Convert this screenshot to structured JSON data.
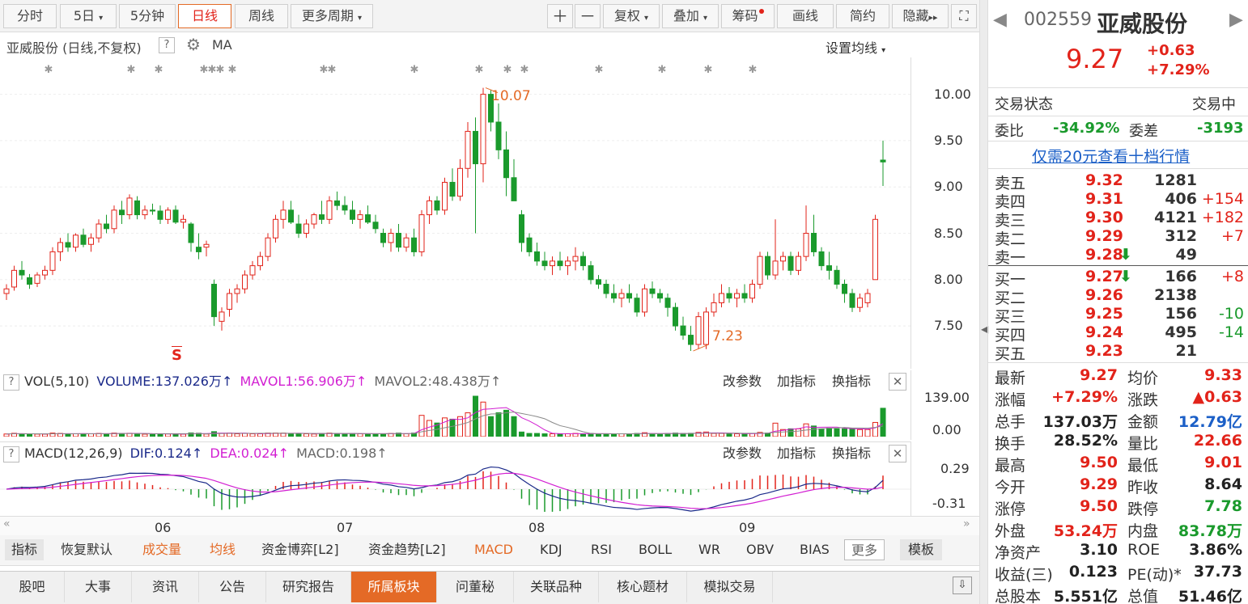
{
  "toolbar": {
    "tabs": [
      "分时",
      "5日",
      "5分钟",
      "日线",
      "周线",
      "更多周期"
    ],
    "active": "日线",
    "right": [
      "复权",
      "叠加",
      "筹码",
      "画线",
      "简约",
      "隐藏"
    ]
  },
  "chart": {
    "title": "亚威股份 (日线,不复权)",
    "ma_label": "MA",
    "ma_settings": "设置均线",
    "high_label": "10.07",
    "low_label": "7.23",
    "y_ticks": [
      "10.00",
      "9.50",
      "9.00",
      "8.50",
      "8.00",
      "7.50"
    ],
    "s_marker": "S"
  },
  "vol": {
    "label": "VOL(5,10)",
    "volume": "VOLUME:137.026万",
    "mavol1": "MAVOL1:56.906万",
    "mavol2": "MAVOL2:48.438万",
    "y_ticks": [
      "139.00",
      "0.00"
    ]
  },
  "macd": {
    "label": "MACD(12,26,9)",
    "dif": "DIF:0.124",
    "dea": "DEA:0.024",
    "macd": "MACD:0.198",
    "y_ticks": [
      "0.29",
      "-0.31"
    ]
  },
  "indicator_tools": [
    "改参数",
    "加指标",
    "换指标"
  ],
  "x_months": [
    "06",
    "07",
    "08",
    "09"
  ],
  "param_tabs": [
    "指标",
    "恢复默认",
    "成交量",
    "均线",
    "资金博弈[L2]",
    "资金趋势[L2]",
    "MACD",
    "KDJ",
    "RSI",
    "BOLL",
    "WR",
    "OBV",
    "BIAS",
    "更多",
    "模板"
  ],
  "bottom_tabs": [
    "股吧",
    "大事",
    "资讯",
    "公告",
    "研究报告",
    "所属板块",
    "问董秘",
    "关联品种",
    "核心题材",
    "模拟交易"
  ],
  "bottom_active": "所属板块",
  "stock": {
    "code": "002559",
    "name": "亚威股份",
    "price": "9.27",
    "change": "+0.63",
    "pct": "+7.29%"
  },
  "status": {
    "label": "交易状态",
    "value": "交易中"
  },
  "weibi": {
    "label": "委比",
    "value": "-34.92%",
    "diff_label": "委差",
    "diff": "-3193"
  },
  "promo": "仅需20元查看十档行情",
  "asks": [
    {
      "label": "卖五",
      "price": "9.32",
      "vol": "1281",
      "chg": ""
    },
    {
      "label": "卖四",
      "price": "9.31",
      "vol": "406",
      "chg": "+154"
    },
    {
      "label": "卖三",
      "price": "9.30",
      "vol": "4121",
      "chg": "+182"
    },
    {
      "label": "卖二",
      "price": "9.29",
      "vol": "312",
      "chg": "+7"
    },
    {
      "label": "卖一",
      "price": "9.28",
      "vol": "49",
      "chg": ""
    }
  ],
  "bids": [
    {
      "label": "买一",
      "price": "9.27",
      "vol": "166",
      "chg": "+8"
    },
    {
      "label": "买二",
      "price": "9.26",
      "vol": "2138",
      "chg": ""
    },
    {
      "label": "买三",
      "price": "9.25",
      "vol": "156",
      "chg": "-10"
    },
    {
      "label": "买四",
      "price": "9.24",
      "vol": "495",
      "chg": "-14"
    },
    {
      "label": "买五",
      "price": "9.23",
      "vol": "21",
      "chg": ""
    }
  ],
  "stats": [
    {
      "l1": "最新",
      "v1": "9.27",
      "c1": "red",
      "l2": "均价",
      "v2": "9.33",
      "c2": "red"
    },
    {
      "l1": "涨幅",
      "v1": "+7.29%",
      "c1": "red",
      "l2": "涨跌",
      "v2": "▲0.63",
      "c2": "red"
    },
    {
      "l1": "总手",
      "v1": "137.03万",
      "c1": "",
      "l2": "金额",
      "v2": "12.79亿",
      "c2": "blue"
    },
    {
      "l1": "换手",
      "v1": "28.52%",
      "c1": "",
      "l2": "量比",
      "v2": "22.66",
      "c2": "red"
    },
    {
      "l1": "最高",
      "v1": "9.50",
      "c1": "red",
      "l2": "最低",
      "v2": "9.01",
      "c2": "red"
    },
    {
      "l1": "今开",
      "v1": "9.29",
      "c1": "red",
      "l2": "昨收",
      "v2": "8.64",
      "c2": ""
    },
    {
      "l1": "涨停",
      "v1": "9.50",
      "c1": "red",
      "l2": "跌停",
      "v2": "7.78",
      "c2": "green"
    },
    {
      "l1": "外盘",
      "v1": "53.24万",
      "c1": "red",
      "l2": "内盘",
      "v2": "83.78万",
      "c2": "green"
    },
    {
      "l1": "净资产",
      "v1": "3.10",
      "c1": "",
      "l2": "ROE",
      "v2": "3.86%",
      "c2": ""
    },
    {
      "l1": "收益(三)",
      "v1": "0.123",
      "c1": "",
      "l2": "PE(动)*",
      "v2": "37.73",
      "c2": ""
    },
    {
      "l1": "总股本",
      "v1": "5.551亿",
      "c1": "",
      "l2": "总值",
      "v2": "51.46亿",
      "c2": ""
    }
  ],
  "colors": {
    "up": "#e2231a",
    "down": "#1a9a2c",
    "accent": "#e46a26",
    "link": "#1b5fc7"
  },
  "chart_data": {
    "type": "candlestick",
    "candles": [
      [
        7.85,
        7.95,
        7.78,
        7.9
      ],
      [
        7.92,
        8.15,
        7.88,
        8.1
      ],
      [
        8.1,
        8.2,
        8.0,
        8.05
      ],
      [
        8.02,
        8.06,
        7.9,
        7.95
      ],
      [
        7.96,
        8.08,
        7.92,
        8.05
      ],
      [
        8.05,
        8.15,
        8.0,
        8.1
      ],
      [
        8.1,
        8.35,
        8.05,
        8.3
      ],
      [
        8.3,
        8.45,
        8.2,
        8.4
      ],
      [
        8.4,
        8.5,
        8.3,
        8.35
      ],
      [
        8.35,
        8.5,
        8.3,
        8.48
      ],
      [
        8.48,
        8.55,
        8.35,
        8.38
      ],
      [
        8.38,
        8.5,
        8.3,
        8.45
      ],
      [
        8.45,
        8.65,
        8.4,
        8.6
      ],
      [
        8.6,
        8.7,
        8.5,
        8.55
      ],
      [
        8.55,
        8.8,
        8.5,
        8.75
      ],
      [
        8.75,
        8.85,
        8.6,
        8.7
      ],
      [
        8.7,
        8.92,
        8.65,
        8.88
      ],
      [
        8.85,
        8.9,
        8.65,
        8.7
      ],
      [
        8.7,
        8.8,
        8.65,
        8.75
      ],
      [
        8.75,
        8.82,
        8.7,
        8.74
      ],
      [
        8.74,
        8.8,
        8.6,
        8.65
      ],
      [
        8.65,
        8.78,
        8.6,
        8.75
      ],
      [
        8.75,
        8.8,
        8.6,
        8.62
      ],
      [
        8.62,
        8.7,
        8.55,
        8.65
      ],
      [
        8.6,
        8.62,
        8.3,
        8.4
      ],
      [
        8.35,
        8.5,
        8.22,
        8.3
      ],
      [
        8.35,
        8.42,
        8.25,
        8.38
      ],
      [
        7.95,
        8.0,
        7.5,
        7.6
      ],
      [
        7.55,
        7.7,
        7.45,
        7.65
      ],
      [
        7.68,
        7.9,
        7.6,
        7.85
      ],
      [
        7.85,
        7.95,
        7.75,
        7.9
      ],
      [
        7.9,
        8.1,
        7.85,
        8.05
      ],
      [
        8.05,
        8.2,
        8.0,
        8.15
      ],
      [
        8.15,
        8.3,
        8.1,
        8.25
      ],
      [
        8.25,
        8.5,
        8.2,
        8.45
      ],
      [
        8.45,
        8.7,
        8.4,
        8.65
      ],
      [
        8.65,
        8.85,
        8.55,
        8.75
      ],
      [
        8.75,
        8.85,
        8.6,
        8.62
      ],
      [
        8.6,
        8.7,
        8.45,
        8.5
      ],
      [
        8.5,
        8.65,
        8.45,
        8.6
      ],
      [
        8.6,
        8.72,
        8.55,
        8.7
      ],
      [
        8.7,
        8.85,
        8.6,
        8.65
      ],
      [
        8.65,
        8.9,
        8.6,
        8.85
      ],
      [
        8.85,
        8.95,
        8.75,
        8.8
      ],
      [
        8.8,
        8.9,
        8.7,
        8.75
      ],
      [
        8.75,
        8.85,
        8.6,
        8.65
      ],
      [
        8.65,
        8.75,
        8.55,
        8.7
      ],
      [
        8.7,
        8.8,
        8.6,
        8.62
      ],
      [
        8.62,
        8.7,
        8.5,
        8.55
      ],
      [
        8.5,
        8.55,
        8.35,
        8.4
      ],
      [
        8.4,
        8.55,
        8.3,
        8.5
      ],
      [
        8.5,
        8.6,
        8.3,
        8.35
      ],
      [
        8.35,
        8.5,
        8.3,
        8.45
      ],
      [
        8.45,
        8.55,
        8.25,
        8.3
      ],
      [
        8.3,
        8.75,
        8.25,
        8.7
      ],
      [
        8.7,
        8.9,
        8.6,
        8.85
      ],
      [
        8.85,
        8.9,
        8.7,
        8.75
      ],
      [
        8.75,
        9.1,
        8.7,
        9.05
      ],
      [
        9.05,
        9.2,
        8.85,
        8.9
      ],
      [
        8.9,
        9.3,
        8.85,
        9.2
      ],
      [
        9.2,
        9.7,
        9.1,
        9.6
      ],
      [
        9.6,
        9.75,
        8.5,
        9.25
      ],
      [
        9.25,
        10.07,
        9.05,
        10.0
      ],
      [
        10.0,
        10.05,
        9.6,
        9.7
      ],
      [
        9.7,
        9.9,
        9.3,
        9.4
      ],
      [
        9.4,
        9.6,
        8.9,
        9.1
      ],
      [
        9.1,
        9.3,
        8.85,
        8.85
      ],
      [
        8.7,
        8.75,
        8.3,
        8.4
      ],
      [
        8.45,
        8.5,
        8.25,
        8.3
      ],
      [
        8.3,
        8.4,
        8.15,
        8.2
      ],
      [
        8.2,
        8.3,
        8.1,
        8.15
      ],
      [
        8.15,
        8.25,
        8.05,
        8.2
      ],
      [
        8.2,
        8.3,
        8.1,
        8.15
      ],
      [
        8.15,
        8.25,
        8.05,
        8.2
      ],
      [
        8.2,
        8.35,
        8.1,
        8.25
      ],
      [
        8.25,
        8.3,
        8.1,
        8.15
      ],
      [
        8.15,
        8.2,
        7.95,
        8.0
      ],
      [
        8.0,
        8.05,
        7.9,
        7.95
      ],
      [
        7.95,
        8.0,
        7.8,
        7.85
      ],
      [
        7.85,
        7.95,
        7.75,
        7.8
      ],
      [
        7.8,
        7.9,
        7.7,
        7.85
      ],
      [
        7.85,
        7.95,
        7.75,
        7.8
      ],
      [
        7.8,
        7.85,
        7.6,
        7.65
      ],
      [
        7.65,
        7.95,
        7.6,
        7.9
      ],
      [
        7.9,
        7.98,
        7.8,
        7.85
      ],
      [
        7.85,
        7.9,
        7.75,
        7.8
      ],
      [
        7.8,
        7.85,
        7.6,
        7.7
      ],
      [
        7.7,
        7.75,
        7.45,
        7.5
      ],
      [
        7.5,
        7.6,
        7.35,
        7.4
      ],
      [
        7.4,
        7.5,
        7.23,
        7.3
      ],
      [
        7.3,
        7.65,
        7.25,
        7.6
      ],
      [
        7.3,
        7.7,
        7.25,
        7.65
      ],
      [
        7.65,
        7.85,
        7.6,
        7.75
      ],
      [
        7.75,
        7.95,
        7.7,
        7.85
      ],
      [
        7.85,
        7.92,
        7.75,
        7.8
      ],
      [
        7.8,
        7.9,
        7.7,
        7.85
      ],
      [
        7.85,
        7.95,
        7.75,
        7.8
      ],
      [
        7.8,
        8.0,
        7.75,
        7.95
      ],
      [
        7.95,
        8.3,
        7.9,
        8.25
      ],
      [
        8.25,
        8.3,
        8.0,
        8.05
      ],
      [
        8.05,
        8.65,
        8.0,
        8.2
      ],
      [
        8.2,
        8.3,
        8.1,
        8.25
      ],
      [
        8.25,
        8.3,
        8.05,
        8.1
      ],
      [
        8.1,
        8.3,
        8.05,
        8.25
      ],
      [
        8.25,
        8.8,
        8.2,
        8.5
      ],
      [
        8.5,
        8.7,
        8.25,
        8.3
      ],
      [
        8.3,
        8.35,
        8.1,
        8.15
      ],
      [
        8.15,
        8.3,
        8.0,
        8.1
      ],
      [
        8.1,
        8.15,
        7.9,
        7.95
      ],
      [
        7.95,
        8.0,
        7.75,
        7.85
      ],
      [
        7.85,
        7.9,
        7.65,
        7.7
      ],
      [
        7.7,
        7.85,
        7.65,
        7.8
      ],
      [
        7.75,
        7.9,
        7.7,
        7.85
      ],
      [
        8.0,
        8.7,
        8.0,
        8.65
      ],
      [
        9.29,
        9.5,
        9.01,
        9.27
      ]
    ]
  }
}
